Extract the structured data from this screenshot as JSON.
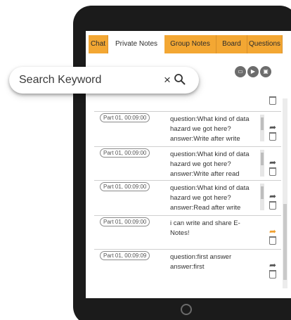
{
  "tabs": [
    "Chat",
    "Private Notes",
    "Group Notes",
    "Board",
    "Questions"
  ],
  "search": {
    "placeholder": "Search Keyword"
  },
  "toolbar": {
    "new_icon": "new-note-icon",
    "play_icon": "play-icon",
    "save_icon": "save-icon"
  },
  "notes": [
    {
      "timestamp": "Part 01, 00:09:00",
      "line1": "question:What kind of data",
      "line2": "hazard we got here?",
      "line3": "answer:Write after write"
    },
    {
      "timestamp": "Part 01, 00:09:00",
      "line1": "question:What kind of data",
      "line2": "hazard we got here?",
      "line3": "answer:Write after read"
    },
    {
      "timestamp": "Part 01, 00:09:00",
      "line1": "question:What kind of data",
      "line2": "hazard we got here?",
      "line3": "answer:Read after write"
    },
    {
      "timestamp": "Part 01, 00:09:00",
      "line1": "i can write and share E-Notes!",
      "line2": "",
      "line3": ""
    },
    {
      "timestamp": "Part 01, 00:09:09",
      "line1": "question:first answer",
      "line2": "answer:first",
      "line3": ""
    }
  ],
  "colors": {
    "tab_bg": "#f3a733",
    "tablet_bezel": "#1b1b1b",
    "shared_icon": "#f0a030"
  }
}
